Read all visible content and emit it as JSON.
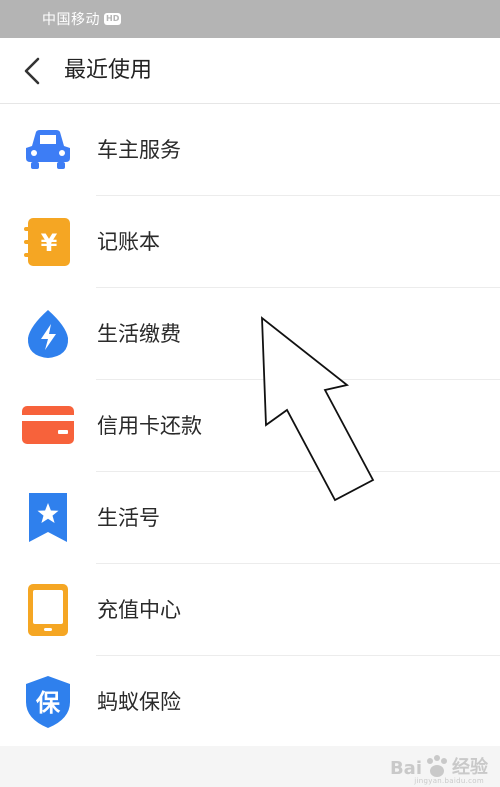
{
  "status_bar": {
    "carrier": "中国移动",
    "hd_badge": "HD"
  },
  "header": {
    "title": "最近使用",
    "back_icon": "chevron-left-icon"
  },
  "items": [
    {
      "label": "车主服务",
      "icon": "car-icon",
      "color": "#3d7df5"
    },
    {
      "label": "记账本",
      "icon": "notebook-yuan-icon",
      "color": "#f5a623"
    },
    {
      "label": "生活缴费",
      "icon": "lightning-drop-icon",
      "color": "#2f80ed"
    },
    {
      "label": "信用卡还款",
      "icon": "credit-card-icon",
      "color": "#f7623b"
    },
    {
      "label": "生活号",
      "icon": "star-bookmark-icon",
      "color": "#2f80ed"
    },
    {
      "label": "充值中心",
      "icon": "tablet-icon",
      "color": "#f5a623"
    },
    {
      "label": "蚂蚁保险",
      "icon": "shield-bao-icon",
      "color": "#2f80ed"
    }
  ],
  "watermark": {
    "text_left": "Bai",
    "text_right": "经验",
    "sub": "jingyan.baidu.com"
  },
  "colors": {
    "status_bar": "#b4b4b4",
    "background": "#f5f5f5",
    "text": "#2a2a2a"
  }
}
